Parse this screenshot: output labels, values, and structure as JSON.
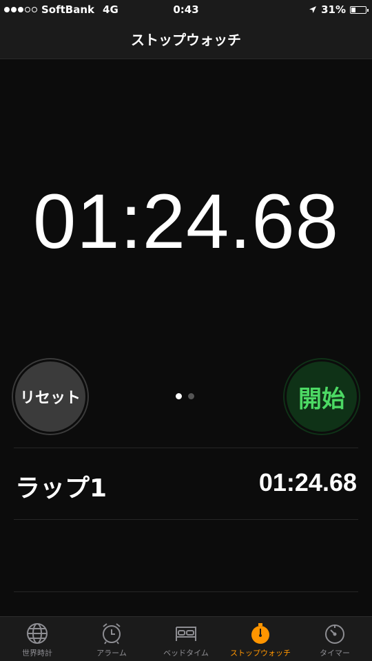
{
  "status_bar": {
    "carrier": "SoftBank",
    "network": "4G",
    "time": "0:43",
    "battery_percent": "31%",
    "battery_level": 0.31,
    "signal_bars": 3,
    "signal_total": 5
  },
  "nav": {
    "title": "ストップウォッチ"
  },
  "stopwatch": {
    "main_time": "01:24.68"
  },
  "buttons": {
    "reset_label": "リセット",
    "start_label": "開始"
  },
  "page_indicator": {
    "count": 2,
    "active": 0
  },
  "laps": [
    {
      "label": "ラップ1",
      "time": "01:24.68"
    }
  ],
  "tabs": [
    {
      "label": "世界時計",
      "icon": "globe-icon"
    },
    {
      "label": "アラーム",
      "icon": "alarm-clock-icon"
    },
    {
      "label": "ベッドタイム",
      "icon": "bed-icon"
    },
    {
      "label": "ストップウォッチ",
      "icon": "stopwatch-icon",
      "active": true
    },
    {
      "label": "タイマー",
      "icon": "timer-icon"
    }
  ],
  "colors": {
    "accent": "#ff9500",
    "start_green": "#4cd964",
    "start_bg": "#0f3217",
    "reset_bg": "#3b3b3b",
    "background": "#0c0c0c",
    "bar_bg": "#1b1b1b"
  }
}
